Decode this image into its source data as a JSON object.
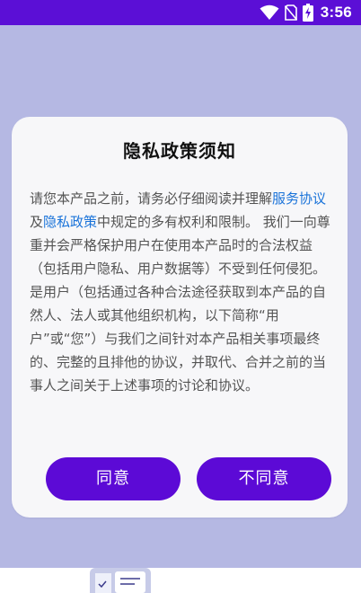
{
  "status_bar": {
    "time": "3:56",
    "icons": [
      "wifi-icon",
      "no-sim-icon",
      "battery-charging-icon"
    ]
  },
  "dialog": {
    "title": "隐私政策须知",
    "body_prefix": "请您本产品之前，请务必仔细阅读并理解",
    "service_agreement_link": "服务协议",
    "joiner": "及",
    "privacy_policy_link": "隐私政策",
    "body_suffix": "中规定的多有权利和限制。 我们一向尊重并会严格保护用户在使用本产品时的合法权益（包括用户隐私、用户数据等）不受到任何侵犯。是用户（包括通过各种合法途径获取到本产品的自然人、法人或其他组织机构，以下简称“用户”或“您”）与我们之间针对本产品相关事项最终的、完整的且排他的协议，并取代、合并之前的当事人之间关于上述事项的讨论和协议。",
    "agree_button": "同意",
    "disagree_button": "不同意"
  },
  "colors": {
    "status_bar": "#5b0fd6",
    "scrim": "#b5b8e3",
    "dialog_bg": "#f7f7f9",
    "button": "#5c0ad6",
    "link": "#1a73d9",
    "body_text": "#545454"
  }
}
